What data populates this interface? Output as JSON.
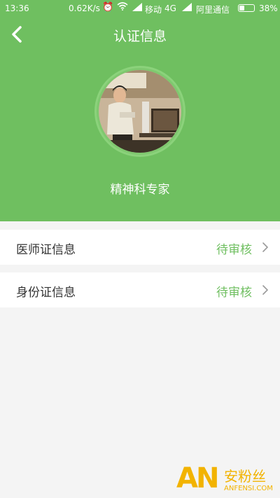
{
  "status_bar": {
    "time": "13:36",
    "network_speed": "0.62K/s",
    "carrier_1": "移动",
    "network_type": "4G",
    "carrier_2": "阿里通信",
    "battery_percent": "38%",
    "battery_level": 0.38
  },
  "nav": {
    "title": "认证信息",
    "back_icon": "chevron-left-icon"
  },
  "profile": {
    "name": "精神科专家",
    "avatar_icon": "avatar-photo"
  },
  "items": [
    {
      "label": "医师证信息",
      "status": "待审核"
    },
    {
      "label": "身份证信息",
      "status": "待审核"
    }
  ],
  "watermark": {
    "logo": "AN",
    "text": "安粉丝",
    "site": "ANFENSI.COM"
  },
  "colors": {
    "primary_green": "#6fbf60",
    "background": "#f4f4f4",
    "watermark": "#f2b300"
  }
}
